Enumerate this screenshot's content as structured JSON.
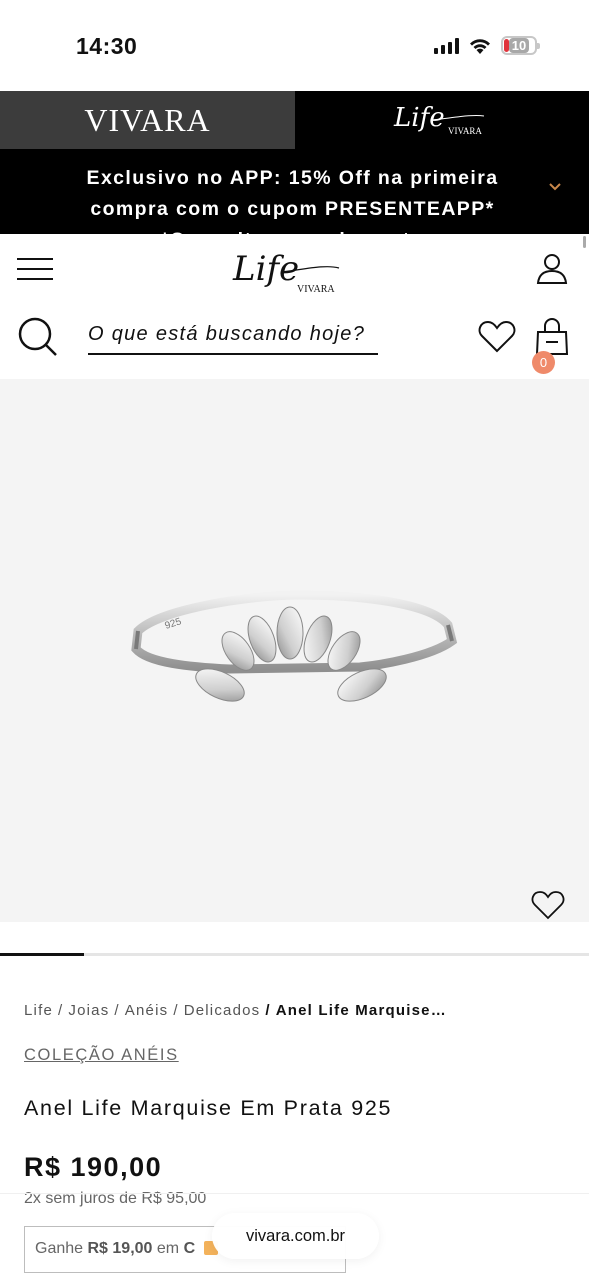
{
  "status_bar": {
    "time": "14:30",
    "battery": "10"
  },
  "brand_tabs": {
    "vivara": "VIVARA",
    "life": "Life",
    "life_sub": "VIVARA"
  },
  "promo": {
    "text": "Exclusivo no APP: 15% Off na primeira compra com o cupom PRESENTEAPP* *Consulte o regulamento"
  },
  "header": {
    "logo": "Life",
    "logo_sub": "VIVARA",
    "search_placeholder": "O que está buscando hoje?",
    "cart_count": "0"
  },
  "breadcrumb": [
    {
      "label": "Life"
    },
    {
      "label": "Joias"
    },
    {
      "label": "Anéis"
    },
    {
      "label": "Delicados"
    }
  ],
  "breadcrumb_current": "Anel Life Marquise…",
  "product": {
    "collection": "COLEÇÃO ANÉIS",
    "title": "Anel Life Marquise Em Prata 925",
    "price": "R$ 190,00",
    "installments": "2x sem juros de R$ 95,00",
    "cashback_prefix": "Ganhe",
    "cashback_amount": "R$ 19,00",
    "cashback_mid": "em",
    "cashback_brand": "C"
  },
  "image": {
    "current_index": 1,
    "total": 7
  },
  "browser": {
    "url": "vivara.com.br"
  },
  "colors": {
    "accent_badge": "#ef8a6a",
    "promo_bg": "#000000",
    "vivara_tab_bg": "#3c3c3c",
    "chevron": "#c8874a"
  }
}
